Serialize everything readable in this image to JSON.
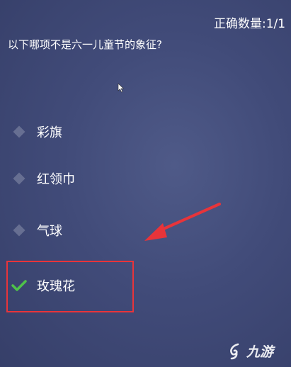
{
  "header": {
    "score_text": "正确数量:1/1"
  },
  "quiz": {
    "question": "以下哪项不是六一儿童节的象征?",
    "options": [
      {
        "label": "彩旗",
        "state": "unselected"
      },
      {
        "label": "红领巾",
        "state": "unselected"
      },
      {
        "label": "气球",
        "state": "unselected"
      },
      {
        "label": "玫瑰花",
        "state": "correct"
      }
    ]
  },
  "annotation": {
    "highlight_color": "#e8343a",
    "arrow_color": "#e8343a",
    "target_option": "玫瑰花"
  },
  "watermark": {
    "logo_icon": "jiuyou-logo-icon",
    "logo_text": "九游"
  },
  "colors": {
    "background": "#414b79",
    "check": "#4fc24a",
    "diamond": "#6f7798"
  }
}
